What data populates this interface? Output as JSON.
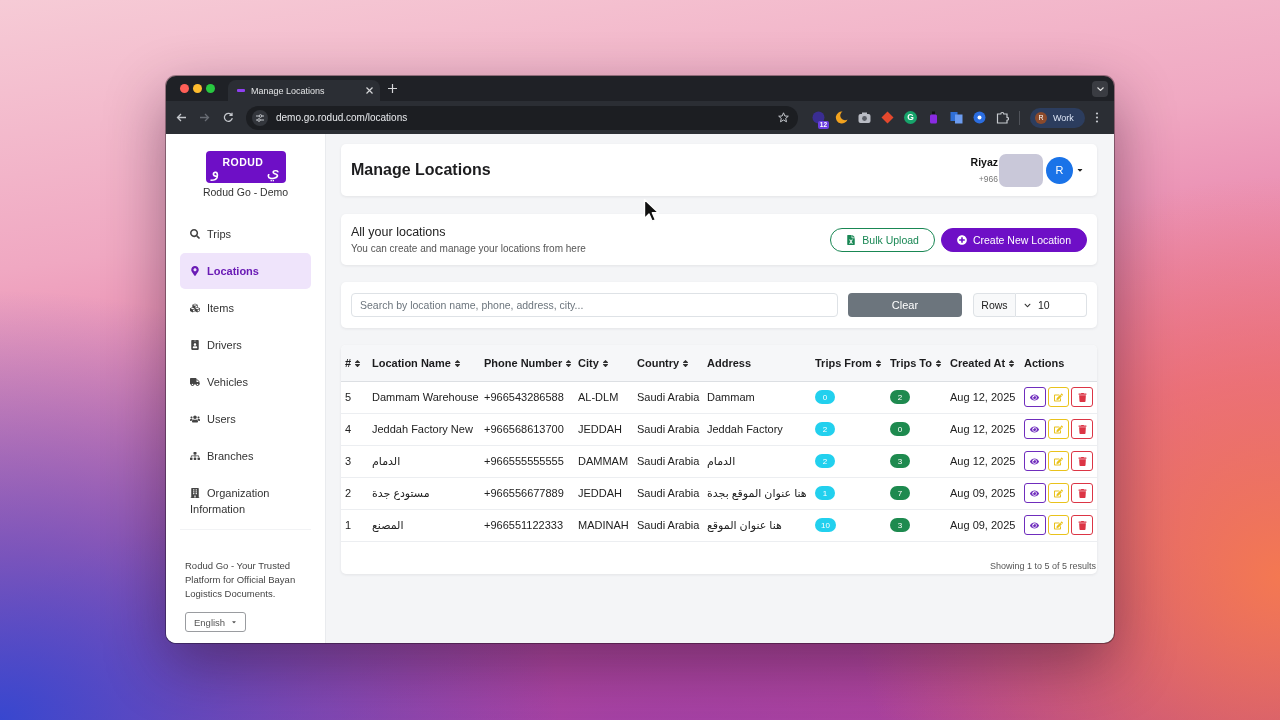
{
  "browser": {
    "tab_title": "Manage Locations",
    "url": "demo.go.rodud.com/locations",
    "extension_badge": "12",
    "extension_letter": "G",
    "profile": {
      "initial": "R",
      "label": "Work"
    }
  },
  "sidebar": {
    "logo": {
      "glyph_left": "و",
      "wordmark": "RODUD",
      "glyph_right": "ي"
    },
    "app_name": "Rodud Go - Demo",
    "items": [
      {
        "label": "Trips",
        "selected": false
      },
      {
        "label": "Locations",
        "selected": true
      },
      {
        "label": "Items",
        "selected": false
      },
      {
        "label": "Drivers",
        "selected": false
      },
      {
        "label": "Vehicles",
        "selected": false
      },
      {
        "label": "Users",
        "selected": false
      },
      {
        "label": "Branches",
        "selected": false
      },
      {
        "label": "Organization Information",
        "selected": false
      }
    ],
    "tagline": "Rodud Go - Your Trusted Platform for Official Bayan Logistics Documents.",
    "language": "English"
  },
  "header": {
    "title": "Manage Locations",
    "user": {
      "name": "Riyaz",
      "phone": "+966",
      "initial": "R"
    }
  },
  "intro": {
    "title": "All your locations",
    "subtitle": "You can create and manage your locations from here",
    "buttons": [
      {
        "label": "Bulk Upload",
        "kind": "outline"
      },
      {
        "label": "Create New Location",
        "kind": "primary"
      }
    ]
  },
  "filters": {
    "search": {
      "placeholder": "Search by location name, phone, address, city..."
    },
    "clear_label": "Clear",
    "rows": {
      "label": "Rows",
      "value": "10"
    }
  },
  "table": {
    "columns": [
      {
        "label": "#",
        "sortable": true
      },
      {
        "label": "Location Name",
        "sortable": true
      },
      {
        "label": "Phone Number",
        "sortable": true
      },
      {
        "label": "City",
        "sortable": true
      },
      {
        "label": "Country",
        "sortable": true
      },
      {
        "label": "Address",
        "sortable": false
      },
      {
        "label": "Trips From",
        "sortable": true
      },
      {
        "label": "Trips To",
        "sortable": true
      },
      {
        "label": "Created At",
        "sortable": true
      },
      {
        "label": "Actions",
        "sortable": false
      }
    ],
    "rows": [
      {
        "number": "5",
        "name": "Dammam Warehouse",
        "phone": "+966543286588",
        "city": "AL-DLM",
        "country": "Saudi Arabia",
        "address": "Dammam",
        "trips_from": "0",
        "trips_to": "2",
        "created_at": "Aug 12, 2025"
      },
      {
        "number": "4",
        "name": "Jeddah Factory New",
        "phone": "+966568613700",
        "city": "JEDDAH",
        "country": "Saudi Arabia",
        "address": "Jeddah Factory",
        "trips_from": "2",
        "trips_to": "0",
        "created_at": "Aug 12, 2025"
      },
      {
        "number": "3",
        "name": "الدمام",
        "phone": "+966555555555",
        "city": "DAMMAM",
        "country": "Saudi Arabia",
        "address": "الدمام",
        "trips_from": "2",
        "trips_to": "3",
        "created_at": "Aug 12, 2025"
      },
      {
        "number": "2",
        "name": "مستودع جدة",
        "phone": "+966556677889",
        "city": "JEDDAH",
        "country": "Saudi Arabia",
        "address": "هنا عنوان الموقع بجدة",
        "trips_from": "1",
        "trips_to": "7",
        "created_at": "Aug 09, 2025"
      },
      {
        "number": "1",
        "name": "المصنع",
        "phone": "+966551122333",
        "city": "MADINAH",
        "country": "Saudi Arabia",
        "address": "هنا عنوان الموقع",
        "trips_from": "10",
        "trips_to": "3",
        "created_at": "Aug 09, 2025"
      }
    ],
    "summary": "Showing 1 to 5 of 5 results"
  }
}
